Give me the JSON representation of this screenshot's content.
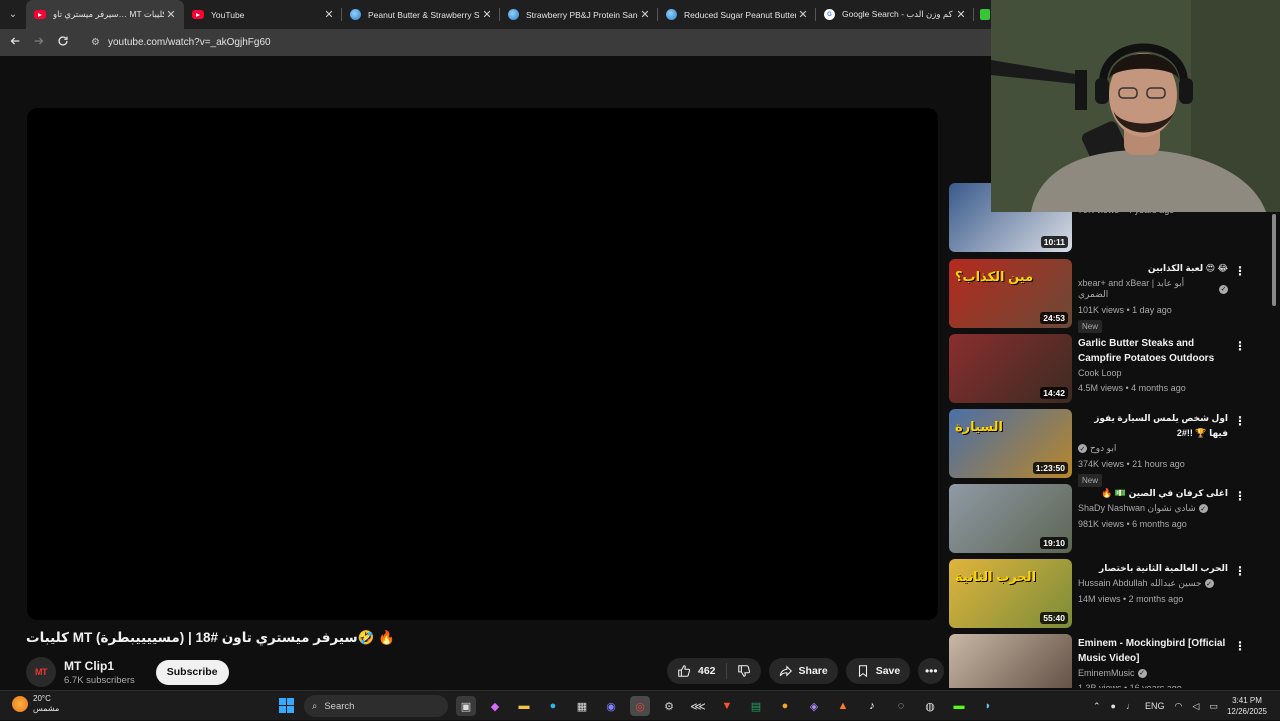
{
  "browser": {
    "tabs": [
      {
        "title": "سيرفر ميستري تاو… MT كليبات",
        "icon": "youtube-icon",
        "active": true
      },
      {
        "title": "YouTube",
        "icon": "youtube-icon",
        "active": false
      },
      {
        "title": "Peanut Butter & Strawberry Spi",
        "icon": "site-icon",
        "active": false
      },
      {
        "title": "Strawberry PB&J Protein Sandw",
        "icon": "site-icon",
        "active": false
      },
      {
        "title": "Reduced Sugar Peanut Butter &",
        "icon": "site-icon",
        "active": false
      },
      {
        "title": "Google Search - كم وزن الدب",
        "icon": "google-icon",
        "active": false
      }
    ],
    "url": "youtube.com/watch?v=_akOgjhFg60"
  },
  "video": {
    "title": "🔥 🤣سيرفر ميستري تاون #18 | (مسييييبطرة) MT كليبات",
    "channel": {
      "name": "MT Clip1",
      "subscribers": "6.7K subscribers",
      "avatar_text": "MT"
    },
    "subscribe_label": "Subscribe",
    "likes": "462",
    "share_label": "Share",
    "save_label": "Save"
  },
  "related": [
    {
      "title": "",
      "channel": "MT clips",
      "channel_rtl": false,
      "verified": false,
      "stats": "79K views • 4 years ago",
      "badge": "",
      "duration": "10:11",
      "thumb_colors": [
        "#3a5a8c",
        "#d9dde4"
      ],
      "thumb_text": "",
      "title_rtl": false
    },
    {
      "title": "😂 😍 لعبة الكذابين",
      "channel": "xbear+ and xBear | أبو عابد الضمري",
      "channel_rtl": false,
      "verified": true,
      "stats": "101K views • 1 day ago",
      "badge": "New",
      "duration": "24:53",
      "thumb_colors": [
        "#b52a1f",
        "#6a4a36"
      ],
      "thumb_text": "مين الكذاب؟",
      "title_rtl": true
    },
    {
      "title": "Garlic Butter Steaks and Campfire Potatoes Outdoors",
      "channel": "Cook Loop",
      "channel_rtl": false,
      "verified": false,
      "stats": "4.5M views • 4 months ago",
      "badge": "",
      "duration": "14:42",
      "thumb_colors": [
        "#8a2e2e",
        "#3b2b22"
      ],
      "thumb_text": "",
      "title_rtl": false
    },
    {
      "title": "اول شخص يلمس السيارة يفوز فيها 🏆 !!#2",
      "channel": "ابو دوح",
      "channel_rtl": true,
      "verified": true,
      "stats": "374K views • 21 hours ago",
      "badge": "New",
      "duration": "1:23:50",
      "thumb_colors": [
        "#4a6fa8",
        "#b8862a"
      ],
      "thumb_text": "السيارة",
      "title_rtl": true
    },
    {
      "title": "اغلى كرفان في الصين 💵 🔥",
      "channel": "ShaDy Nashwan شادي نشوان",
      "channel_rtl": false,
      "verified": true,
      "stats": "981K views • 6 months ago",
      "badge": "",
      "duration": "19:10",
      "thumb_colors": [
        "#8f9aa6",
        "#5d6552"
      ],
      "thumb_text": "",
      "title_rtl": true
    },
    {
      "title": "الحرب العالمية الثانية باختصار",
      "channel": "Hussain Abdullah حسين عبدالله",
      "channel_rtl": false,
      "verified": true,
      "stats": "14M views • 2 months ago",
      "badge": "",
      "duration": "55:40",
      "thumb_colors": [
        "#e0b43c",
        "#7a8c3a"
      ],
      "thumb_text": "الحرب الثانية",
      "title_rtl": true
    },
    {
      "title": "Eminem - Mockingbird [Official Music Video]",
      "channel": "EminemMusic",
      "channel_rtl": false,
      "verified": true,
      "stats": "1.3B views • 16 years ago",
      "badge": "",
      "duration": "",
      "thumb_colors": [
        "#c9b8a6",
        "#5b4a3e"
      ],
      "thumb_text": "",
      "title_rtl": false
    }
  ],
  "taskbar": {
    "weather_temp": "20°C",
    "weather_desc": "مشمس",
    "search_placeholder": "Search",
    "language": "ENG",
    "time": "3:41 PM",
    "date": "12/26/2025"
  },
  "colors": {
    "background": "#0f0f0f",
    "accent_red": "#ff0033",
    "chip": "#272727"
  }
}
